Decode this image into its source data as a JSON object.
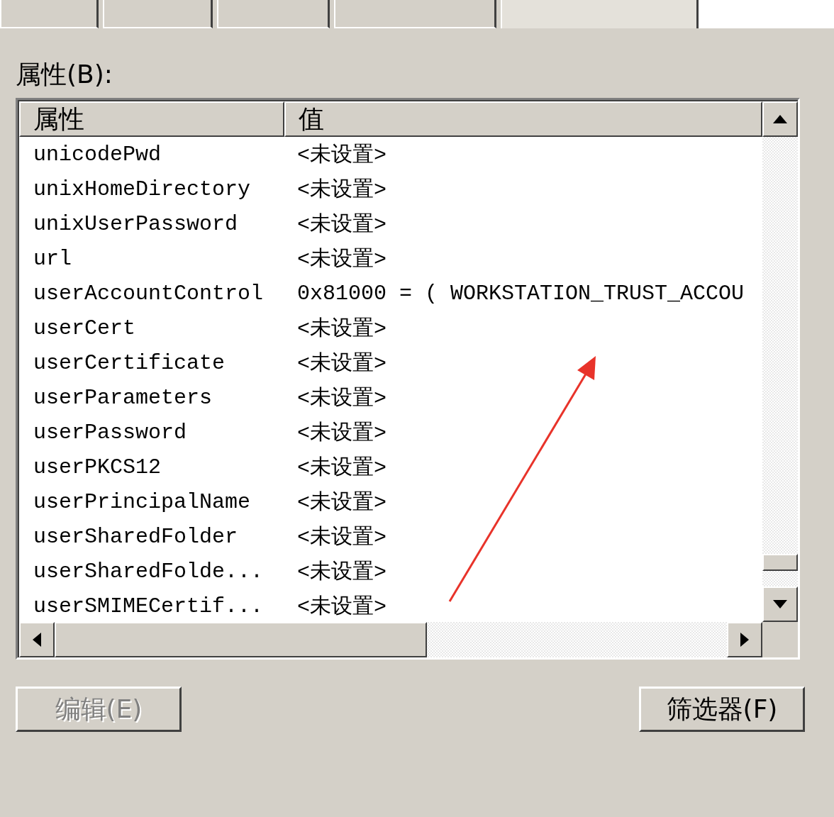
{
  "tabs": [
    {
      "selected": false
    },
    {
      "selected": false
    },
    {
      "selected": false
    },
    {
      "selected": false
    },
    {
      "selected": true
    }
  ],
  "attributes_label": "属性(B):",
  "table": {
    "columns": [
      "属性",
      "值"
    ],
    "rows": [
      {
        "name": "unicodePwd",
        "value": "<未设置>"
      },
      {
        "name": "unixHomeDirectory",
        "value": "<未设置>"
      },
      {
        "name": "unixUserPassword",
        "value": "<未设置>"
      },
      {
        "name": "url",
        "value": "<未设置>"
      },
      {
        "name": "userAccountControl",
        "value": "0x81000 = ( WORKSTATION_TRUST_ACCOU"
      },
      {
        "name": "userCert",
        "value": "<未设置>"
      },
      {
        "name": "userCertificate",
        "value": "<未设置>"
      },
      {
        "name": "userParameters",
        "value": "<未设置>"
      },
      {
        "name": "userPassword",
        "value": "<未设置>"
      },
      {
        "name": "userPKCS12",
        "value": "<未设置>"
      },
      {
        "name": "userPrincipalName",
        "value": "<未设置>"
      },
      {
        "name": "userSharedFolder",
        "value": "<未设置>"
      },
      {
        "name": "userSharedFolde...",
        "value": "<未设置>"
      },
      {
        "name": "userSMIMECertif...",
        "value": "<未设置>"
      }
    ]
  },
  "buttons": [
    {
      "label": "编辑(E)",
      "disabled": true
    },
    {
      "label": "筛选器(F)",
      "disabled": false
    }
  ]
}
